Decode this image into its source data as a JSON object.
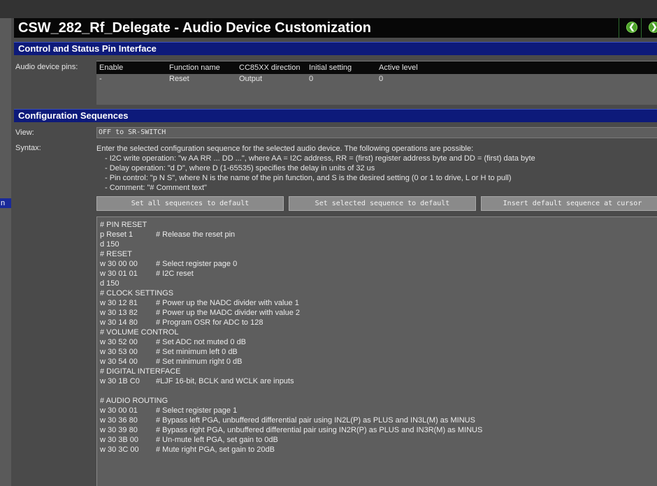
{
  "window": {
    "title": "CSW_282_Rf_Delegate - Audio Device Customization"
  },
  "nav": {
    "back_glyph": "❮",
    "forward_glyph": "❯",
    "back_icon": "arrow-left-circle-icon",
    "forward_icon": "arrow-right-circle-icon"
  },
  "left_panel": {
    "selected_item_fragment": "n"
  },
  "pins": {
    "section_title": "Control and Status Pin Interface",
    "label": "Audio device pins:",
    "columns": [
      "Enable",
      "Function name",
      "CC85XX direction",
      "Initial setting",
      "Active level"
    ],
    "rows": [
      [
        "-",
        "Reset",
        "Output",
        "0",
        "0"
      ]
    ]
  },
  "config": {
    "section_title": "Configuration Sequences",
    "view_label": "View:",
    "view_value": "OFF to SR-SWITCH",
    "syntax_label": "Syntax:",
    "syntax_intro": "Enter the selected configuration sequence for the selected audio device. The following operations are possible:",
    "syntax_items": [
      "- I2C write operation: \"w AA RR ... DD ...\", where AA = I2C address, RR = (first) register address byte and DD = (first) data byte",
      "- Delay operation: \"d D\", where D (1-65535) specifies the delay in units of 32 us",
      "- Pin control: \"p N S\", where N is the name of the pin function, and S is the desired setting (0 or 1 to drive, L or H to pull)",
      "- Comment: \"# Comment text\""
    ],
    "buttons": {
      "set_all": "Set all sequences to default",
      "set_selected": "Set selected sequence to default",
      "insert_default": "Insert default sequence at cursor"
    },
    "lines": [
      {
        "code": "# PIN RESET",
        "comment": ""
      },
      {
        "code": "p Reset 1",
        "comment": "# Release the reset pin"
      },
      {
        "code": "d  150",
        "comment": ""
      },
      {
        "code": "# RESET",
        "comment": ""
      },
      {
        "code": "w 30 00 00",
        "comment": "# Select register page 0"
      },
      {
        "code": "w 30 01 01",
        "comment": "# I2C reset"
      },
      {
        "code": "d  150",
        "comment": ""
      },
      {
        "code": "# CLOCK SETTINGS",
        "comment": ""
      },
      {
        "code": "w 30 12 81",
        "comment": "# Power up the NADC divider with value 1"
      },
      {
        "code": "w 30 13 82",
        "comment": "# Power up the MADC divider with value 2"
      },
      {
        "code": "w 30 14 80",
        "comment": "# Program OSR for ADC to 128"
      },
      {
        "code": "# VOLUME CONTROL",
        "comment": ""
      },
      {
        "code": "w 30 52 00",
        "comment": "# Set ADC not muted  0 dB"
      },
      {
        "code": "w 30 53 00",
        "comment": "# Set minimum left   0 dB"
      },
      {
        "code": "w 30 54 00",
        "comment": "# Set minimum right 0 dB"
      },
      {
        "code": "# DIGITAL INTERFACE",
        "comment": ""
      },
      {
        "code": "w 30 1B C0",
        "comment": "#LJF 16-bit, BCLK and WCLK are inputs"
      },
      {
        "code": "",
        "comment": ""
      },
      {
        "code": "# AUDIO ROUTING",
        "comment": ""
      },
      {
        "code": "w 30 00 01",
        "comment": "# Select register page 1"
      },
      {
        "code": "w 30 36 80",
        "comment": "# Bypass left PGA, unbuffered differential pair using IN2L(P) as PLUS and IN3L(M) as MINUS"
      },
      {
        "code": "w 30 39 80",
        "comment": "# Bypass right PGA, unbuffered differential pair using IN2R(P) as PLUS and IN3R(M) as MINUS"
      },
      {
        "code": "w 30 3B 00",
        "comment": "# Un-mute left PGA, set gain to 0dB"
      },
      {
        "code": "w 30 3C 00",
        "comment": "# Mute right PGA, set gain to 20dB"
      }
    ]
  }
}
